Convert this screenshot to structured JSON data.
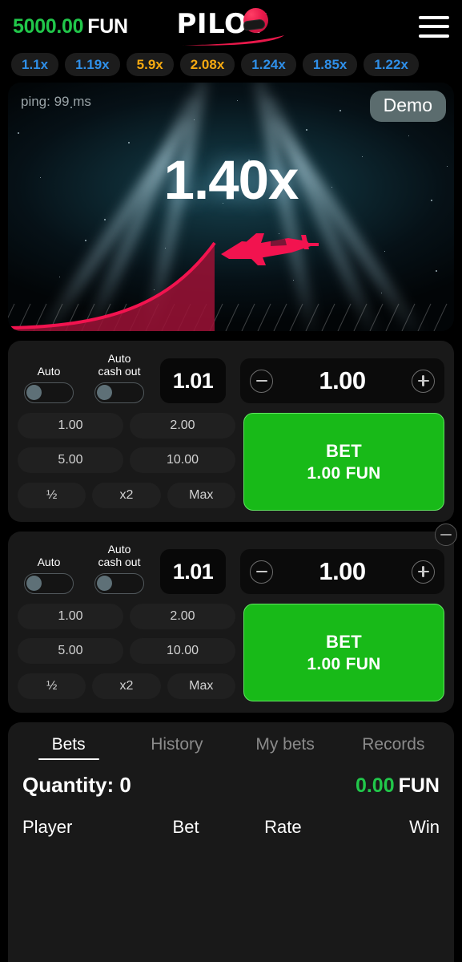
{
  "header": {
    "balance_amount": "5000.00",
    "currency": "FUN",
    "logo_text": "PILOT",
    "menu_icon": "hamburger-menu-icon"
  },
  "history": {
    "chips": [
      {
        "label": "1.1x",
        "tone": "blue"
      },
      {
        "label": "1.19x",
        "tone": "blue"
      },
      {
        "label": "5.9x",
        "tone": "gold"
      },
      {
        "label": "2.08x",
        "tone": "gold"
      },
      {
        "label": "1.24x",
        "tone": "blue"
      },
      {
        "label": "1.85x",
        "tone": "blue"
      },
      {
        "label": "1.22x",
        "tone": "blue"
      }
    ]
  },
  "game": {
    "ping": "ping: 99 ms",
    "demo_label": "Demo",
    "multiplier": "1.40x",
    "plane_icon": "airplane-icon"
  },
  "bet_panels": [
    {
      "auto_label": "Auto",
      "auto_cashout_label": "Auto\ncash out",
      "auto_cashout_value": "1.01",
      "amount": "1.00",
      "minus_icon": "minus-circle-icon",
      "plus_icon": "plus-circle-icon",
      "quick_amounts": [
        "1.00",
        "2.00",
        "5.00",
        "10.00"
      ],
      "modifiers": [
        "½",
        "x2",
        "Max"
      ],
      "bet_line1": "BET",
      "bet_line2": "1.00 FUN",
      "removable": false
    },
    {
      "auto_label": "Auto",
      "auto_cashout_label": "Auto\ncash out",
      "auto_cashout_value": "1.01",
      "amount": "1.00",
      "minus_icon": "minus-circle-icon",
      "plus_icon": "plus-circle-icon",
      "quick_amounts": [
        "1.00",
        "2.00",
        "5.00",
        "10.00"
      ],
      "modifiers": [
        "½",
        "x2",
        "Max"
      ],
      "bet_line1": "BET",
      "bet_line2": "1.00 FUN",
      "removable": true,
      "remove_icon": "remove-panel-icon"
    }
  ],
  "bottom": {
    "tabs": [
      {
        "label": "Bets",
        "active": true
      },
      {
        "label": "History",
        "active": false
      },
      {
        "label": "My bets",
        "active": false
      },
      {
        "label": "Records",
        "active": false
      }
    ],
    "quantity_label": "Quantity: 0",
    "total_amount": "0.00",
    "total_currency": "FUN",
    "columns": [
      "Player",
      "Bet",
      "Rate",
      "Win"
    ]
  },
  "colors": {
    "balance_green": "#21c74a",
    "bet_green": "#18ba18",
    "chip_blue": "#2f8fe8",
    "chip_gold": "#f5a911",
    "plane_red": "#e8184a",
    "panel_bg": "#191919"
  }
}
